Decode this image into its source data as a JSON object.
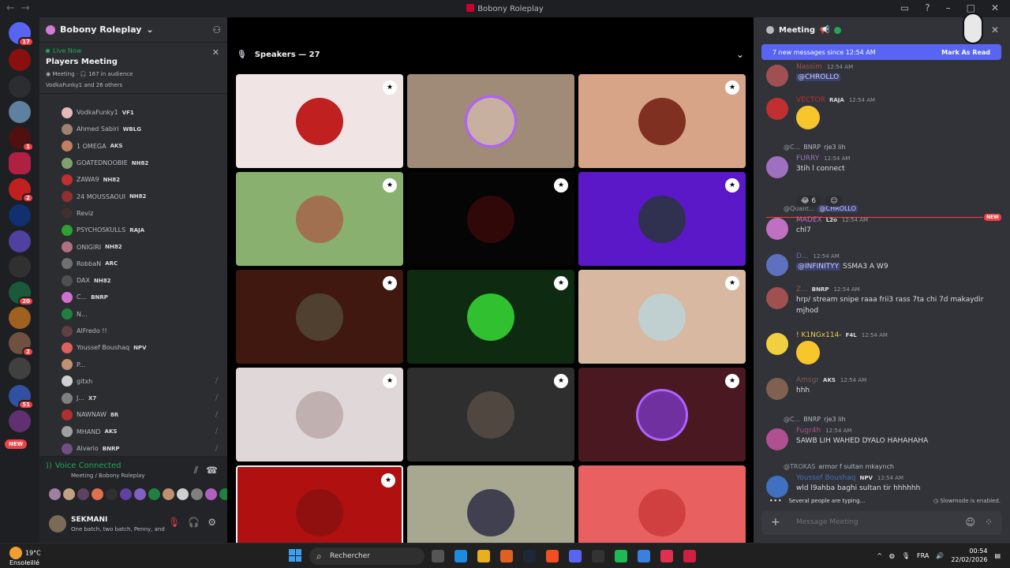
{
  "window": {
    "title": "Bobony Roleplay"
  },
  "servers": {
    "badges": [
      "17",
      "1",
      "2",
      "20",
      "2",
      "51"
    ],
    "new_label": "NEW"
  },
  "guild": {
    "name": "Bobony Roleplay"
  },
  "live": {
    "status": "Live Now",
    "title": "Players Meeting",
    "channel": "Meeting",
    "audience": "167 in audience",
    "speakers_text": "VodkaFunky1",
    "others": "and 26 others"
  },
  "members": [
    {
      "name": "VodkaFunky1",
      "tag": "VF1",
      "color": "#e8b8b8"
    },
    {
      "name": "Ahmed Sabiri",
      "tag": "WBLG",
      "color": "#a08070"
    },
    {
      "name": "1 OMEGA",
      "tag": "AKS",
      "color": "#c08060"
    },
    {
      "name": "GOATEDNOOBIE",
      "tag": "NH82",
      "color": "#80a070"
    },
    {
      "name": "ZAWA9",
      "tag": "NH82",
      "color": "#c03030"
    },
    {
      "name": "24 MOUSSAOUI",
      "tag": "NH82",
      "color": "#903030"
    },
    {
      "name": "Reviz",
      "tag": "",
      "color": "#403030"
    },
    {
      "name": "PSYCHOSKULLS",
      "tag": "RAJA",
      "color": "#30a030"
    },
    {
      "name": "ONIGIRI",
      "tag": "NH82",
      "color": "#b07080"
    },
    {
      "name": "RobbaN",
      "tag": "ARC",
      "color": "#707070"
    },
    {
      "name": "DAX",
      "tag": "NH82",
      "color": "#505050"
    },
    {
      "name": "C...",
      "tag": "BNRP",
      "color": "#d070d0"
    },
    {
      "name": "N...",
      "tag": "",
      "color": "#208040"
    },
    {
      "name": "AlFredo !!",
      "tag": "",
      "color": "#604040"
    },
    {
      "name": "Youssef Boushaq",
      "tag": "NPV",
      "color": "#e06060"
    },
    {
      "name": "P...",
      "tag": "",
      "color": "#c09070"
    },
    {
      "name": "gitxh",
      "tag": "",
      "color": "#d0d0d0"
    },
    {
      "name": "J...",
      "tag": "X7",
      "color": "#808080"
    },
    {
      "name": "NAWNAW",
      "tag": "8R",
      "color": "#b03030"
    },
    {
      "name": "MHAND",
      "tag": "AKS",
      "color": "#a0a0a0"
    },
    {
      "name": "Alvario",
      "tag": "BNRP",
      "color": "#705080"
    }
  ],
  "voice": {
    "status": "Voice Connected",
    "channel": "Meeting",
    "guild_suffix": "/ Bobony Roleplay"
  },
  "user": {
    "name": "SEKMANI",
    "status": "One batch, two batch, Penny, and"
  },
  "stage": {
    "speakers_label": "Speakers — 27",
    "tiles": [
      {
        "bg": "#f0e4e4",
        "av": "#c02020",
        "shield": true
      },
      {
        "bg": "#a08a78",
        "av": "#c8b0a0",
        "shield": false
      },
      {
        "bg": "#d8a488",
        "av": "#803020",
        "shield": true
      },
      {
        "bg": "#8ab070",
        "av": "#a07050",
        "shield": true
      },
      {
        "bg": "#050505",
        "av": "#300808",
        "shield": true
      },
      {
        "bg": "#5a18c8",
        "av": "#303050",
        "shield": true
      },
      {
        "bg": "#401810",
        "av": "#504030",
        "shield": true
      },
      {
        "bg": "#0e2a10",
        "av": "#30c030",
        "shield": true
      },
      {
        "bg": "#d8b8a0",
        "av": "#c0d0d0",
        "shield": true
      },
      {
        "bg": "#e0d8d8",
        "av": "#c0b0b0",
        "shield": true
      },
      {
        "bg": "#2e2e2e",
        "av": "#504840",
        "shield": true
      },
      {
        "bg": "#4a1820",
        "av": "#7030a0",
        "shield": true
      },
      {
        "bg": "#b01010",
        "av": "#901010",
        "shield": true
      },
      {
        "bg": "#a8a890",
        "av": "#404050",
        "shield": false
      },
      {
        "bg": "#e86060",
        "av": "#d04040",
        "shield": false
      }
    ]
  },
  "chat": {
    "title": "Meeting",
    "new_messages": "7 new messages since 12:54 AM",
    "mark_read": "Mark As Read",
    "new_tag": "NEW",
    "messages": [
      {
        "name": "Nassim",
        "name_color": "#a05050",
        "time": "12:54 AM",
        "content": "@CHROLLO",
        "reply": ""
      },
      {
        "name": "VECTOR",
        "name_color": "#c03030",
        "tag": "RAJA",
        "time": "12:54 AM",
        "content": "",
        "reply": ""
      },
      {
        "name": "FURRY",
        "name_color": "#a070c0",
        "time": "12:54 AM",
        "content": "3tih l connect",
        "reply_user": "@C...",
        "reply_tag": "BNRP",
        "reply_text": "rje3 lih"
      },
      {
        "name": "MADEX",
        "name_color": "#c070c0",
        "tag": "L2o",
        "time": "12:54 AM",
        "content": "chl7",
        "reply_user": "@Qualit...",
        "reply_text": "@CHROLLO"
      },
      {
        "name": "D...",
        "name_color": "#6070c0",
        "time": "12:54 AM",
        "content": "SSMA3 A W9",
        "mention": "@INFINITYY"
      },
      {
        "name": "Z...",
        "name_color": "#a05050",
        "tag": "BNRP",
        "time": "12:54 AM",
        "content": "hrp/ stream snipe raaa frii3 rass 7ta chi 7d makaydir",
        "content2": "mjhod"
      },
      {
        "name": "! K1NGx114-",
        "name_color": "#f0d040",
        "tag": "F4L",
        "time": "12:54 AM",
        "content": ""
      },
      {
        "name": "Amsgr",
        "name_color": "#806050",
        "tag": "AKS",
        "time": "12:54 AM",
        "content": "hhh"
      },
      {
        "name": "Fugr4h",
        "name_color": "#b05090",
        "time": "12:54 AM",
        "content": "SAWB LIH WAHED DYALO HAHAHAHA",
        "reply_user": "@C...",
        "reply_tag": "BNRP",
        "reply_text": "rje3 lih"
      },
      {
        "name": "Youssef Boushaq",
        "name_color": "#4070c0",
        "tag": "NPV",
        "time": "12:54 AM",
        "content": "wld l9ahba baghi sultan tir hhhhhh",
        "reply_user": "@TROKAS",
        "reply_text": "armor f sultan mkaynch"
      }
    ],
    "reaction_count": "6",
    "typing": "Several people are typing...",
    "slowmode": "Slowmode is enabled.",
    "placeholder": "Message Meeting"
  },
  "taskbar": {
    "temp": "19°C",
    "weather": "Ensoleillé",
    "weather_badge": "2",
    "search": "Rechercher",
    "lang": "FRA",
    "time": "00:54",
    "date": "22/02/2026"
  }
}
